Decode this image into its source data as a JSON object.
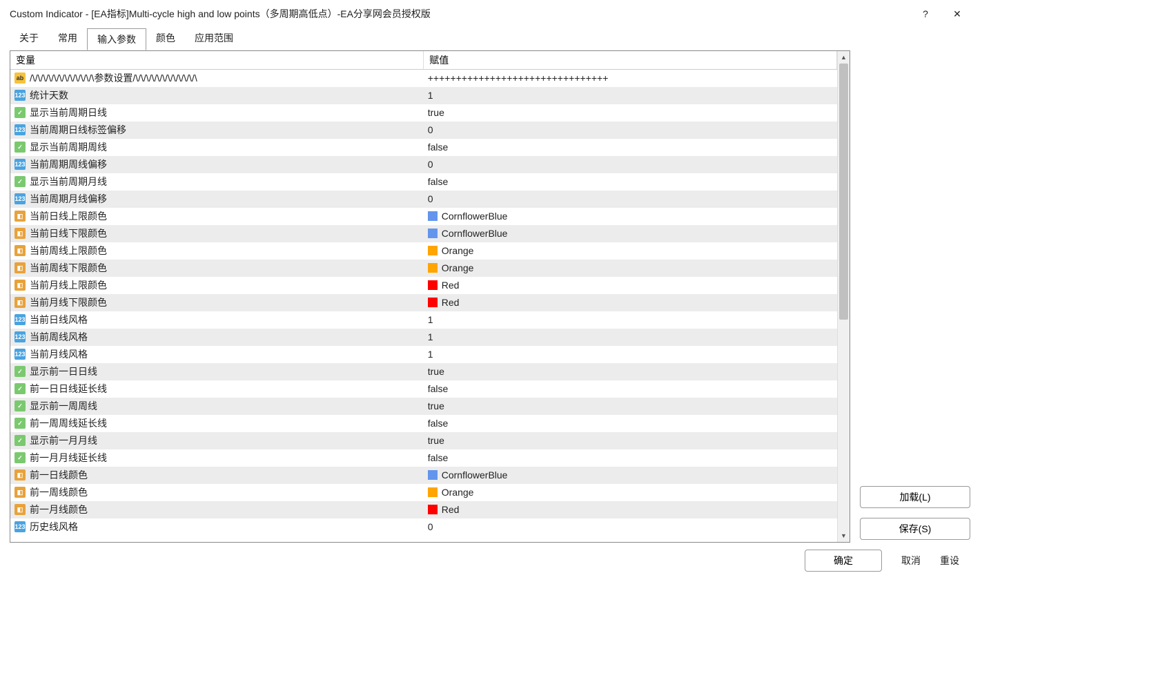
{
  "window": {
    "title": "Custom Indicator - [EA指标]Multi-cycle high and low points（多周期高低点）-EA分享网会员授权版"
  },
  "tabs": {
    "items": [
      "关于",
      "常用",
      "输入参数",
      "颜色",
      "应用范围"
    ],
    "active_index": 2
  },
  "table": {
    "headers": {
      "variable": "变量",
      "value": "赋值"
    },
    "rows": [
      {
        "type": "str",
        "name": "/\\/\\/\\/\\/\\/\\/\\/\\/\\/\\/\\/\\参数设置/\\/\\/\\/\\/\\/\\/\\/\\/\\/\\/\\/\\",
        "value": "++++++++++++++++++++++++++++++++"
      },
      {
        "type": "num",
        "name": "统计天数",
        "value": "1"
      },
      {
        "type": "bool",
        "name": "显示当前周期日线",
        "value": "true"
      },
      {
        "type": "num",
        "name": "当前周期日线标签偏移",
        "value": "0"
      },
      {
        "type": "bool",
        "name": "显示当前周期周线",
        "value": "false"
      },
      {
        "type": "num",
        "name": "当前周期周线偏移",
        "value": "0"
      },
      {
        "type": "bool",
        "name": "显示当前周期月线",
        "value": "false"
      },
      {
        "type": "num",
        "name": "当前周期月线偏移",
        "value": "0"
      },
      {
        "type": "color",
        "name": "当前日线上限颜色",
        "value": "CornflowerBlue",
        "swatch": "#6495ED"
      },
      {
        "type": "color",
        "name": "当前日线下限颜色",
        "value": "CornflowerBlue",
        "swatch": "#6495ED"
      },
      {
        "type": "color",
        "name": "当前周线上限颜色",
        "value": "Orange",
        "swatch": "#FFA500"
      },
      {
        "type": "color",
        "name": "当前周线下限颜色",
        "value": "Orange",
        "swatch": "#FFA500"
      },
      {
        "type": "color",
        "name": "当前月线上限颜色",
        "value": "Red",
        "swatch": "#FF0000"
      },
      {
        "type": "color",
        "name": "当前月线下限颜色",
        "value": "Red",
        "swatch": "#FF0000"
      },
      {
        "type": "num",
        "name": "当前日线风格",
        "value": "1"
      },
      {
        "type": "num",
        "name": "当前周线风格",
        "value": "1"
      },
      {
        "type": "num",
        "name": "当前月线风格",
        "value": "1"
      },
      {
        "type": "bool",
        "name": "显示前一日日线",
        "value": "true"
      },
      {
        "type": "bool",
        "name": "前一日日线延长线",
        "value": "false"
      },
      {
        "type": "bool",
        "name": "显示前一周周线",
        "value": "true"
      },
      {
        "type": "bool",
        "name": "前一周周线延长线",
        "value": "false"
      },
      {
        "type": "bool",
        "name": "显示前一月月线",
        "value": "true"
      },
      {
        "type": "bool",
        "name": "前一月月线延长线",
        "value": "false"
      },
      {
        "type": "color",
        "name": "前一日线颜色",
        "value": "CornflowerBlue",
        "swatch": "#6495ED"
      },
      {
        "type": "color",
        "name": "前一周线颜色",
        "value": "Orange",
        "swatch": "#FFA500"
      },
      {
        "type": "color",
        "name": "前一月线颜色",
        "value": "Red",
        "swatch": "#FF0000"
      },
      {
        "type": "num",
        "name": "历史线风格",
        "value": "0"
      }
    ]
  },
  "side": {
    "load": "加载(L)",
    "save": "保存(S)"
  },
  "footer": {
    "ok": "确定",
    "cancel": "取消",
    "reset": "重设"
  },
  "icons": {
    "str": "ab",
    "num": "123",
    "bool": "✓",
    "color": "◧"
  }
}
